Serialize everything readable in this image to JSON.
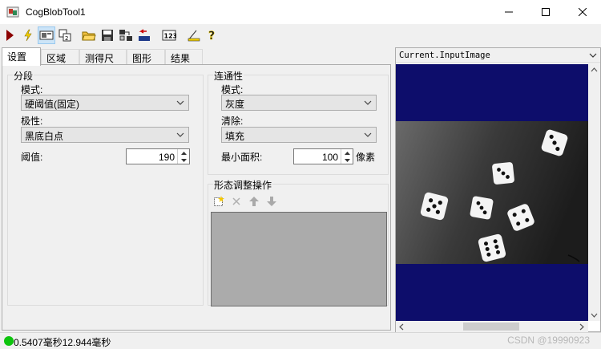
{
  "window": {
    "title": "CogBlobTool1"
  },
  "toolbar": {
    "items": [
      "run-icon",
      "electric-icon",
      "display-icon",
      "zoom-icon",
      "open-icon",
      "save-icon",
      "import-icon",
      "reset-icon",
      "numeric-icon",
      "measure-icon",
      "help-icon"
    ]
  },
  "tabs": [
    "设置",
    "区域",
    "测得尺寸",
    "图形",
    "结果"
  ],
  "segmentation": {
    "group_label": "分段",
    "mode_label": "模式:",
    "mode_value": "硬阈值(固定)",
    "polarity_label": "极性:",
    "polarity_value": "黑底白点",
    "threshold_label": "阈值:",
    "threshold_value": "190"
  },
  "connectivity": {
    "group_label": "连通性",
    "mode_label": "模式:",
    "mode_value": "灰度",
    "cleanup_label": "清除:",
    "cleanup_value": "填充",
    "min_area_label": "最小面积:",
    "min_area_value": "100",
    "unit_label": "像素"
  },
  "morphology": {
    "group_label": "形态调整操作"
  },
  "image_panel": {
    "selected": "Current.InputImage"
  },
  "status": {
    "text": "0.5407毫秒12.944毫秒",
    "watermark": "CSDN @19990923",
    "color": "#0ec40e"
  }
}
